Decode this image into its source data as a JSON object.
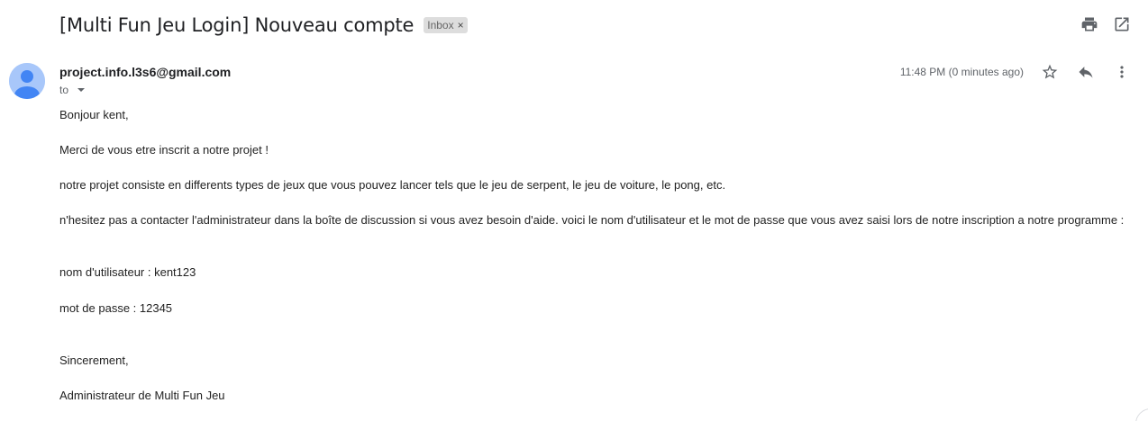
{
  "email": {
    "subject": "[Multi Fun Jeu Login] Nouveau compte",
    "label": "Inbox",
    "label_remove_glyph": "×",
    "sender": "project.info.l3s6@gmail.com",
    "to_label": "to",
    "time": "11:48 PM (0 minutes ago)"
  },
  "icons": {
    "print": "print-icon",
    "open_new_window": "open-in-new-icon",
    "star": "star-icon",
    "reply": "reply-icon",
    "more": "more-vert-icon",
    "avatar": "person-avatar-icon"
  },
  "body": {
    "greeting": "Bonjour kent,",
    "thanks": "Merci de vous etre inscrit a notre projet !",
    "description": "notre projet consiste en differents types de jeux que vous pouvez lancer tels que le jeu de serpent, le jeu de voiture, le pong, etc.",
    "help": "n'hesitez pas a contacter l'administrateur dans la boîte de discussion si vous avez besoin d'aide. voici le nom d'utilisateur et le mot de passe que vous avez saisi lors de notre inscription a notre programme :",
    "username_line": "nom d'utilisateur : kent123",
    "password_line": "mot de passe : 12345",
    "closing": "Sincerement,",
    "signature": "Administrateur de Multi Fun Jeu"
  },
  "colors": {
    "avatar_bg": "#a8c7fa",
    "avatar_fg": "#4285f4",
    "chip_bg": "#dddddd"
  }
}
